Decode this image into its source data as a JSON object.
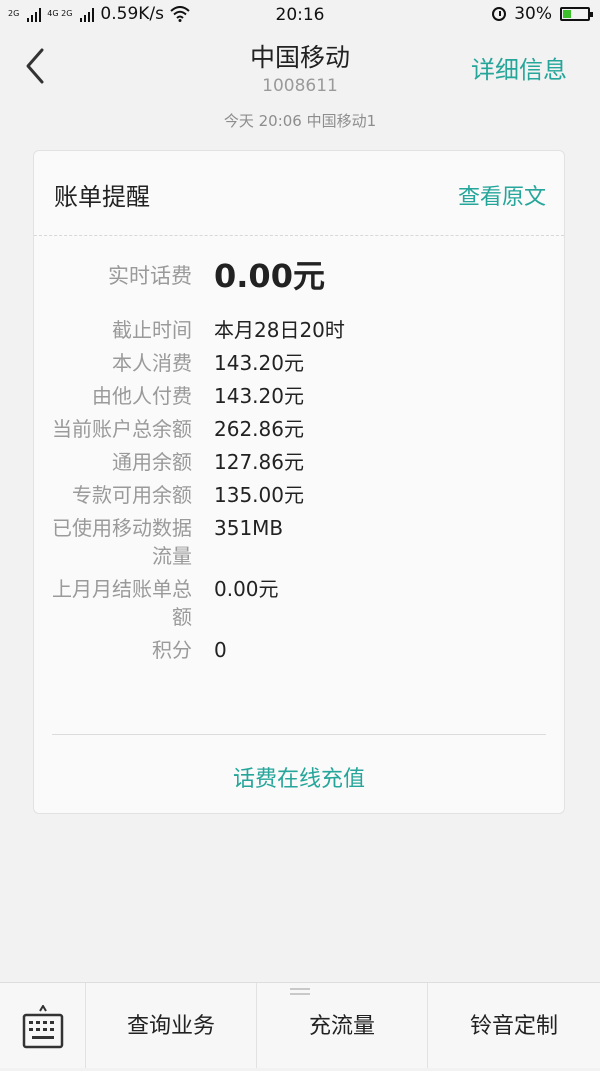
{
  "status_bar": {
    "signal1_label": "2G",
    "signal2_label": "4G 2G",
    "speed": "0.59K/s",
    "time": "20:16",
    "battery": "30%",
    "battery_level": 0.3,
    "icons": [
      "signal-icon",
      "wifi-icon",
      "alarm-icon",
      "battery-icon"
    ]
  },
  "header": {
    "title": "中国移动",
    "subtitle": "1008611",
    "detail_label": "详细信息"
  },
  "message": {
    "timestamp": "今天  20:06  中国移动1"
  },
  "card": {
    "title": "账单提醒",
    "view_original": "查看原文",
    "rows": [
      {
        "label": "实时话费",
        "value": "0.00元"
      },
      {
        "label": "截止时间",
        "value": "本月28日20时"
      },
      {
        "label": "本人消费",
        "value": "143.20元"
      },
      {
        "label": "由他人付费",
        "value": "143.20元"
      },
      {
        "label": "当前账户总余额",
        "value": "262.86元"
      },
      {
        "label": "通用余额",
        "value": "127.86元"
      },
      {
        "label": "专款可用余额",
        "value": "135.00元"
      },
      {
        "label": "已使用移动数据流量",
        "value": "351MB"
      },
      {
        "label": "上月月结账单总额",
        "value": "0.00元"
      },
      {
        "label": "积分",
        "value": "0"
      }
    ],
    "recharge_label": "话费在线充值"
  },
  "bottom_menu": {
    "items": [
      "查询业务",
      "充流量",
      "铃音定制"
    ]
  },
  "colors": {
    "accent": "#26a69a",
    "background": "#f2f2f2",
    "label_gray": "#9a9a9a"
  }
}
